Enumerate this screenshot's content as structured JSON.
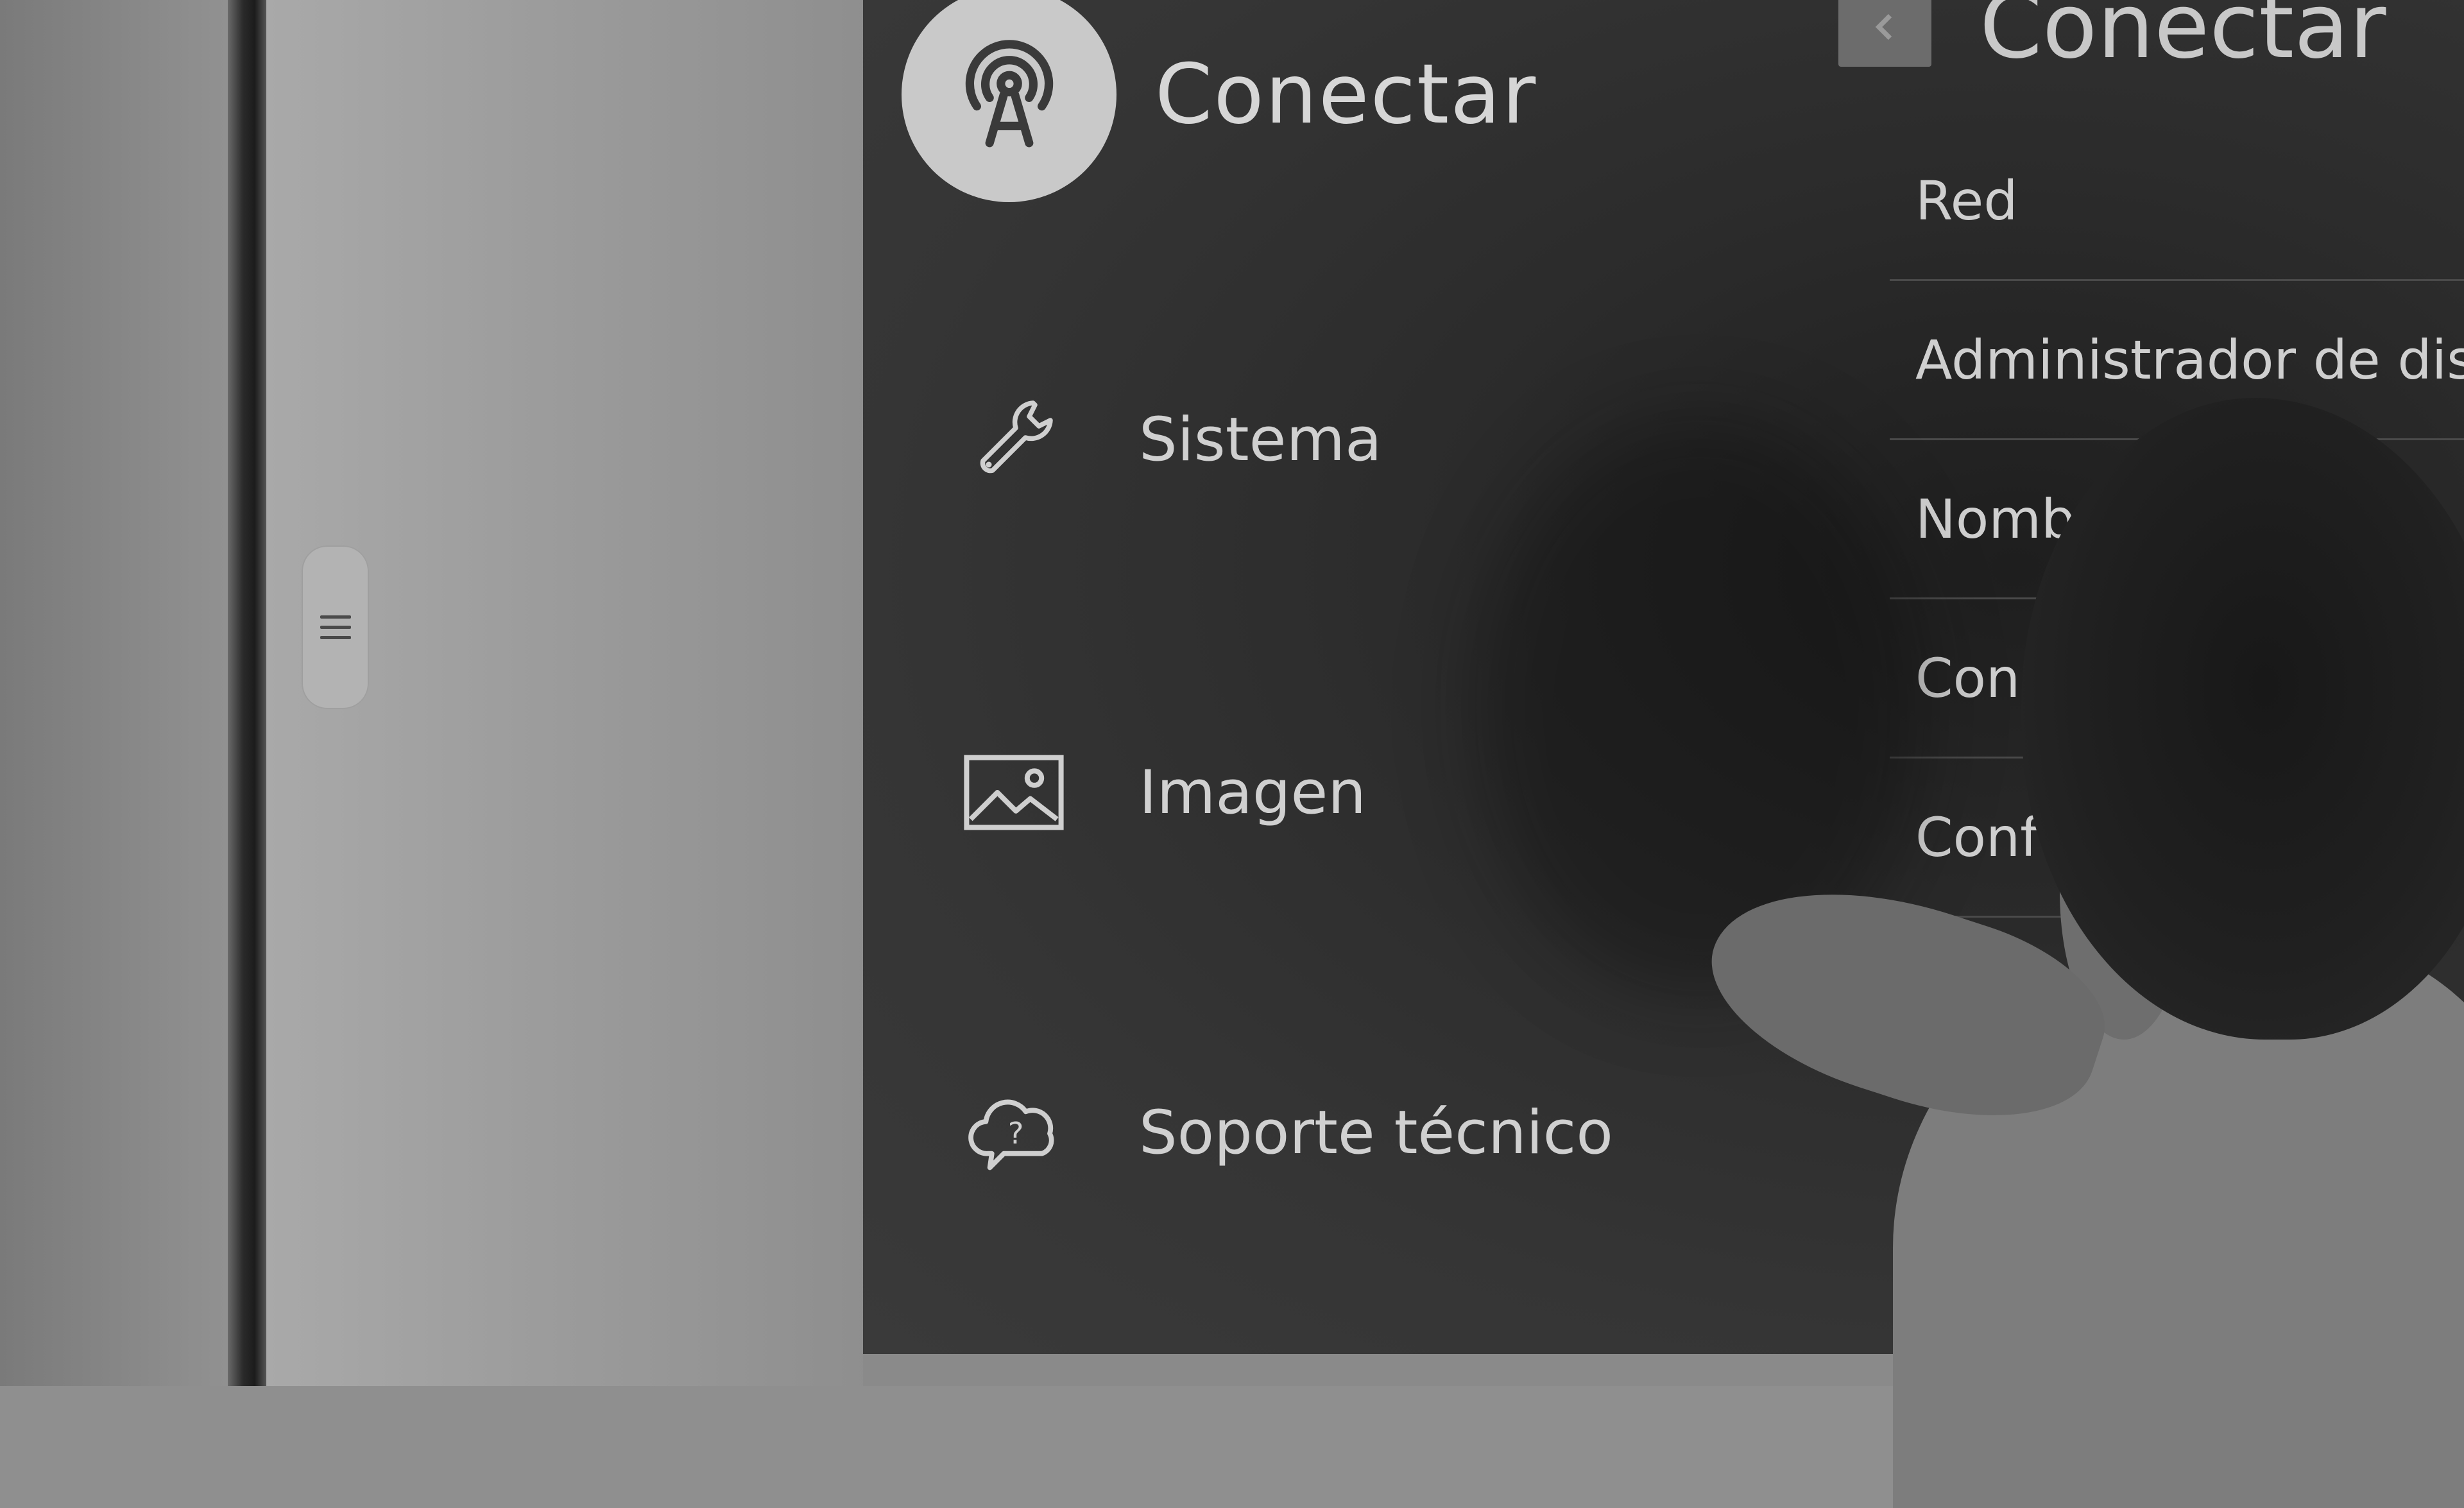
{
  "menu": {
    "header_label": "Conectar",
    "items": [
      {
        "label": "Sistema",
        "icon": "wrench-icon"
      },
      {
        "label": "Imagen",
        "icon": "image-icon"
      },
      {
        "label": "Soporte técnico",
        "icon": "help-cloud-icon"
      }
    ]
  },
  "submenu": {
    "title": "Conectar",
    "items": [
      {
        "label": "Red"
      },
      {
        "label": "Administrador de dispo"
      },
      {
        "label": "Nomb"
      },
      {
        "label": "Con"
      },
      {
        "label": "Conf"
      }
    ]
  }
}
